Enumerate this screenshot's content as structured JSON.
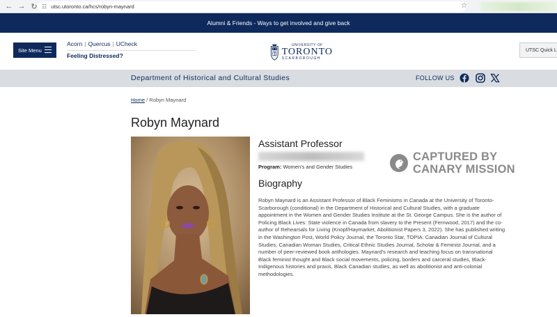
{
  "browser": {
    "url": "utsc.utoronto.ca/hcs/robyn-maynard",
    "back_icon": "arrow-left-icon",
    "forward_icon": "arrow-right-icon",
    "reload_icon": "reload-icon",
    "bookmark_icon": "star-icon"
  },
  "banner": {
    "text": "Alumni & Friends - Ways to get involved and give back"
  },
  "header": {
    "site_menu": "Site Menu",
    "links": [
      "Acorn",
      "Quercus",
      "UCheck"
    ],
    "distressed": "Feeling Distressed?",
    "logo": {
      "university": "UNIVERSITY OF",
      "name": "TORONTO",
      "campus": "SCARBOROUGH"
    },
    "quick_links": "UTSC Quick Links"
  },
  "dept_bar": {
    "title": "Department of Historical and Cultural Studies",
    "follow_us": "FOLLOW US"
  },
  "breadcrumb": {
    "home": "Home",
    "separator": "/",
    "current": "Robyn Maynard"
  },
  "profile": {
    "name": "Robyn Maynard",
    "role": "Assistant Professor",
    "program_label": "Program:",
    "program_value": "Women's and Gender Studies",
    "bio_heading": "Biography",
    "bio_text": "Robyn Maynard is an Assistant Professor of Black Feminisms in Canada at the University of Toronto-Scarborough (conditional) in the Department of Historical and Cultural Studies, with a graduate appointment in the Women and Gender Studies Institute at the St. George Campus. She is the author of Policing Black Lives: State violence in Canada from slavery to the Present (Fernwood, 2017) and the co-author of Rehearsals for Living (Knopf/Haymarket, Abolitionist Papers 3, 2022).  She has published writing in the Washington Post, World Policy Journal, the Toronto Star, TOPIA: Canadian Journal of Cultural Studies, Canadian Woman Studies, Critical Ethnic Studies Journal, Scholar & Feminist Journal, and a number of peer-reviewed book anthologies. Maynard's research and teaching focus on transnational Black feminist thought and Black social movements, policing, borders and carceral studies, Black-Indigenous histories and praxis, Black Canadian studies, as well as abolitionist and anti-colonial methodologies."
  },
  "watermark": {
    "line1": "CAPTURED BY",
    "line2": "CANARY MISSION"
  },
  "colors": {
    "navy": "#0e2a5c",
    "dept_bar": "#d9dde1"
  }
}
